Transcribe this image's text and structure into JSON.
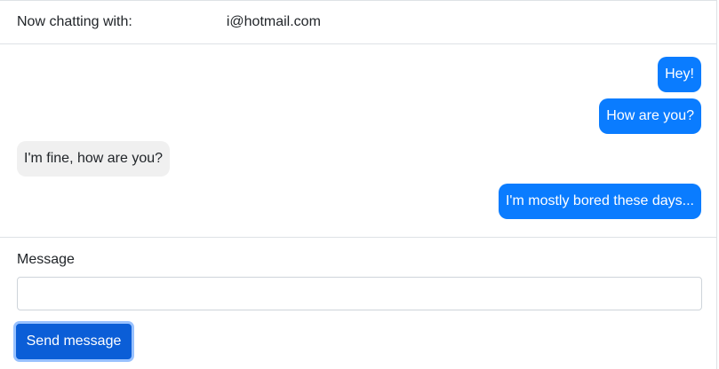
{
  "header": {
    "label": "Now chatting with:",
    "contact_email": "i@hotmail.com"
  },
  "messages": [
    {
      "text": "Hey!",
      "direction": "sent"
    },
    {
      "text": "How are you?",
      "direction": "sent"
    },
    {
      "text": "I'm fine, how are you?",
      "direction": "received"
    },
    {
      "text": "I'm mostly bored these days...",
      "direction": "sent"
    }
  ],
  "composer": {
    "label": "Message",
    "value": "",
    "placeholder": "",
    "send_label": "Send message"
  },
  "colors": {
    "sent_bubble": "#0a7cff",
    "received_bubble": "#f0f0f0",
    "primary_button": "#0b5ed7"
  }
}
